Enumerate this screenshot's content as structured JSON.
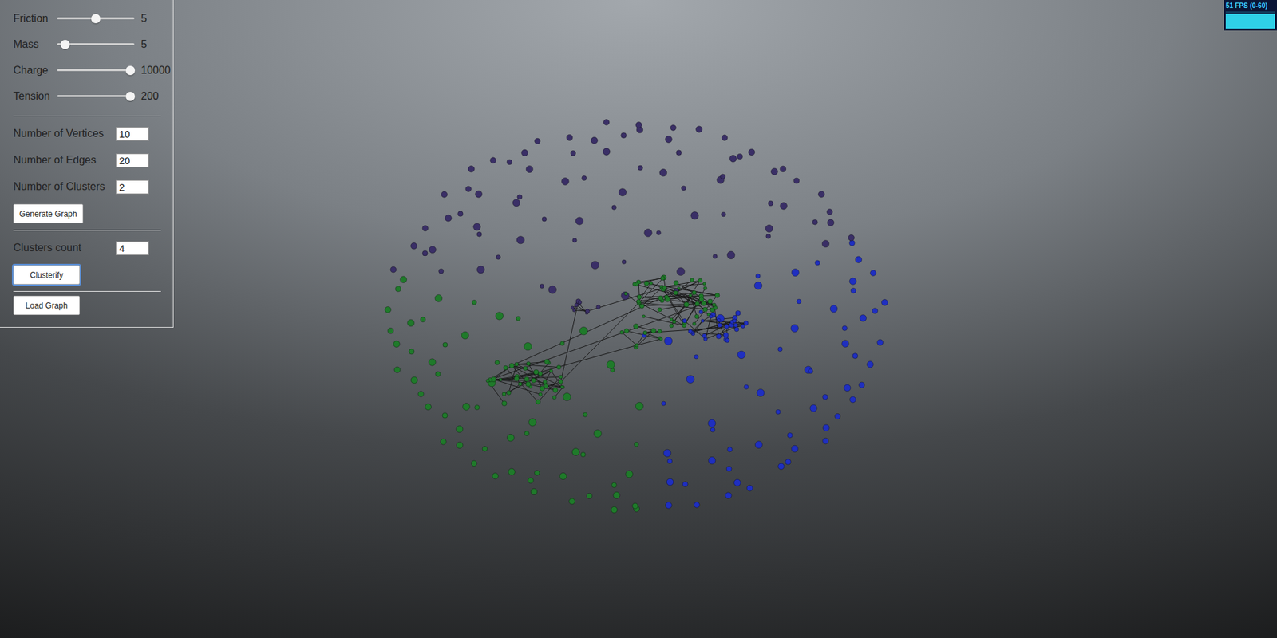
{
  "controls": {
    "sliders": [
      {
        "label": "Friction",
        "value": "5",
        "level": 0.5
      },
      {
        "label": "Mass",
        "value": "5",
        "level": 0.1
      },
      {
        "label": "Charge",
        "value": "10000",
        "level": 0.95
      },
      {
        "label": "Tension",
        "value": "200",
        "level": 0.95
      }
    ],
    "generator": {
      "fields": [
        {
          "label": "Number of Vertices",
          "value": "10"
        },
        {
          "label": "Number of Edges",
          "value": "20"
        },
        {
          "label": "Number of Clusters",
          "value": "2"
        }
      ],
      "button": "Generate Graph"
    },
    "clusterify": {
      "field": {
        "label": "Clusters count",
        "value": "4"
      },
      "button": "Clusterify",
      "focused": true
    },
    "load": {
      "button": "Load Graph"
    }
  },
  "stats": {
    "fps": "51 FPS (0-60)",
    "level": 0.85
  },
  "graph": {
    "clusters": [
      {
        "color": "#3a2f66"
      },
      {
        "color": "#1f2fc0"
      },
      {
        "color": "#1f7a2a"
      }
    ]
  }
}
